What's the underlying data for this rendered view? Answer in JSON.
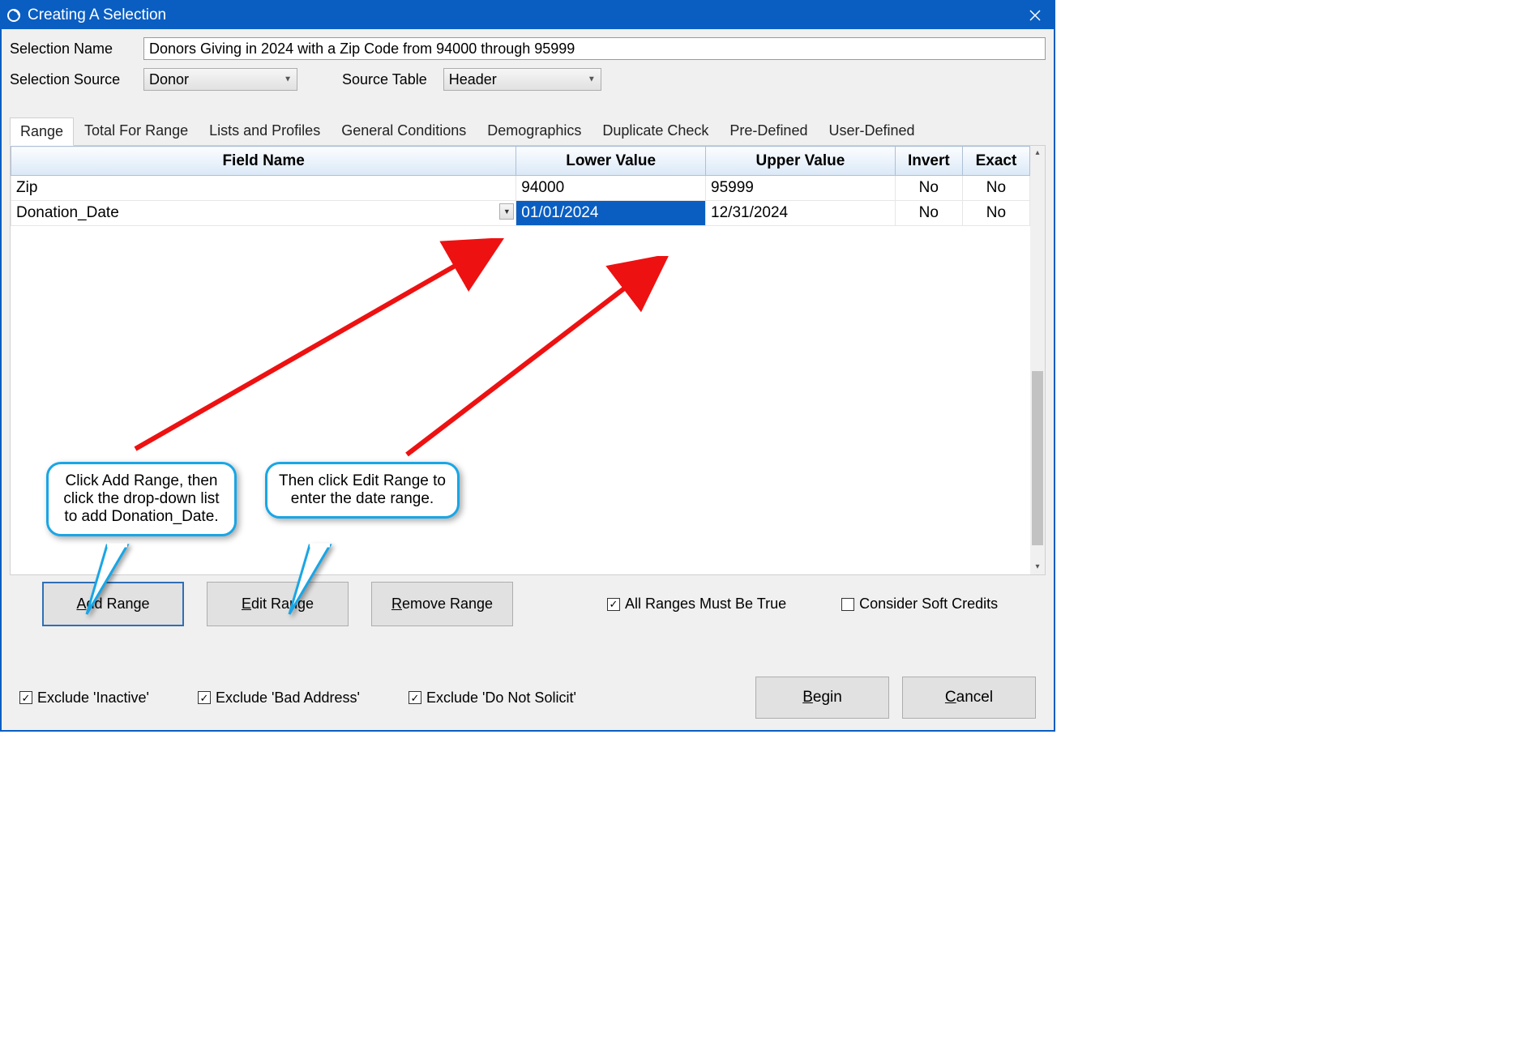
{
  "window": {
    "title": "Creating A Selection"
  },
  "form": {
    "name_label": "Selection Name",
    "name_value": "Donors Giving in 2024 with a Zip Code from 94000 through 95999",
    "source_label": "Selection Source",
    "source_value": "Donor",
    "table_label": "Source Table",
    "table_value": "Header"
  },
  "tabs": [
    "Range",
    "Total For Range",
    "Lists and Profiles",
    "General Conditions",
    "Demographics",
    "Duplicate Check",
    "Pre-Defined",
    "User-Defined"
  ],
  "active_tab_index": 0,
  "grid": {
    "headers": {
      "field": "Field Name",
      "lower": "Lower Value",
      "upper": "Upper Value",
      "invert": "Invert",
      "exact": "Exact"
    },
    "rows": [
      {
        "field": "Zip",
        "lower": "94000",
        "upper": "95999",
        "invert": "No",
        "exact": "No",
        "show_dd": false,
        "lower_selected": false
      },
      {
        "field": "Donation_Date",
        "lower": "01/01/2024",
        "upper": "12/31/2024",
        "invert": "No",
        "exact": "No",
        "show_dd": true,
        "lower_selected": true
      }
    ]
  },
  "range_buttons": {
    "add": "Add Range",
    "edit": "Edit Range",
    "remove": "Remove Range"
  },
  "range_checks": {
    "all_true": {
      "label": "All Ranges Must Be True",
      "checked": true
    },
    "soft_credits": {
      "label": "Consider Soft Credits",
      "checked": false
    }
  },
  "footer_checks": {
    "inactive": {
      "label": "Exclude 'Inactive'",
      "checked": true
    },
    "bad_addr": {
      "label": "Exclude 'Bad Address'",
      "checked": true
    },
    "dns": {
      "label": "Exclude 'Do Not Solicit'",
      "checked": true
    }
  },
  "footer_buttons": {
    "begin": "Begin",
    "cancel": "Cancel"
  },
  "callouts": {
    "c1": "Click Add Range, then click the drop-down list to add Donation_Date.",
    "c2": "Then click Edit Range to enter the date range."
  }
}
